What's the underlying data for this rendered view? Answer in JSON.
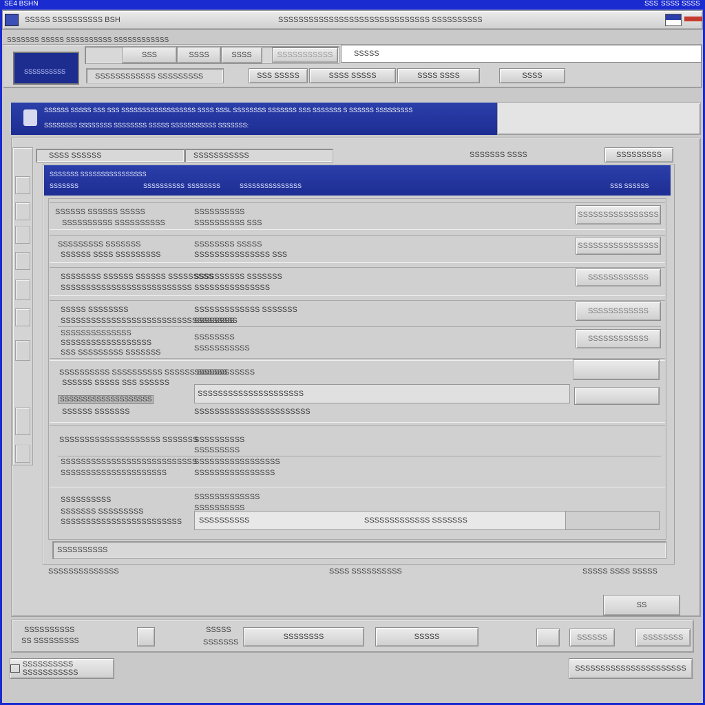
{
  "titlebar": {
    "title": "SE4 BSHN",
    "controls": [
      "SSS",
      "SSSS",
      "SSSS"
    ]
  },
  "menubar": {
    "left": "SSSSS  SSSSSSSSSS BSH",
    "center": "SSSSSSSSSSSSSSSSSSSSSSSSSSSSSS SSSSSSSSSS"
  },
  "toolbar": {
    "caption": "SSSSSSS SSSSS SSSSSSSSSS SSSSSSSSSSSS",
    "preview_text": "SSSSSSSSSS",
    "top_tabs": [
      "SSS",
      "SSSS",
      "SSSS",
      "SSSSSSSSSSS"
    ],
    "search_value": "SSSSS",
    "subtitle": "SSSSSSSSSSSS SSSSSSSSS",
    "sub_tabs": [
      "SSS SSSSS",
      "SSSS SSSSS",
      "SSSS SSSS",
      "SSSS"
    ]
  },
  "banner": {
    "line1": "SSSSSS SSSSS SSS SSS SSSSSSSSSSSSSSSSSS SSSS SSSL SSSSSSSS SSSSSSS SSS SSSSSSS S SSSSSS SSSSSSSSS",
    "line2": "SSSSSSSS SSSSSSSS SSSSSSSS SSSSS SSSSSSSSSSS SSSSSSS:"
  },
  "subheader": {
    "left": "SSSS  SSSSSS",
    "middle": "SSSSSSSSSSS",
    "right": "SSSSSSS  SSSS",
    "button": "SSSSSSSSS"
  },
  "group_header": {
    "title": "SSSSSSS SSSSSSSSSSSSSSSS",
    "cols": [
      "SSSSSSS",
      "SSSSSSSSSS",
      "SSSSSSSS",
      "SSSSSSSSSSSSSSS"
    ],
    "right": "SSS SSSSSS"
  },
  "rows": [
    {
      "label": "SSSSSS SSSSSS SSSSS",
      "sub": "SSSSSSSSSS SSSSSSSSSS",
      "value": "SSSSSSSSSS",
      "value2": "SSSSSSSSSS SSS",
      "button": "SSSSSSSSSSSSSSSS"
    },
    {
      "label": "SSSSSSSSS SSSSSSS",
      "sub": "SSSSSS SSSS SSSSSSSSS",
      "value": "SSSSSSSS SSSSS",
      "value2": "SSSSSSSSSSSSSSS SSS",
      "button": "SSSSSSSSSSSSSSSS"
    },
    {
      "label": "SSSSSSSS SSSSSS  SSSSSS SSSSSSSSS",
      "sub": "SSSSSSSSSSSSSSSSSSSSSSSSSS",
      "value": "SSSSSSSSSS SSSSSSS",
      "value2": "SSSSSSSSSSSSSSS",
      "button": "SSSSSSSSSSSS"
    },
    {
      "label": "SSSSS SSSSSSSS",
      "sub": "SSSSSSSSSSSSSSSSSSSSSSSSSSSSSSSSSSS",
      "value": "SSSSSSSSSSSSS SSSSSSS",
      "value2": "SSSSSSSS",
      "button": "SSSSSSSSSSSS"
    },
    {
      "label": "SSSSSSSSSSSSSS",
      "sub": "SSSSSSSSSSSSSSSSSS",
      "extra": "SSS SSSSSSSSS SSSSSSS",
      "value": "SSSSSSSS",
      "value2": "SSSSSSSSSSS",
      "button": "SSSSSSSSSSSS"
    },
    {
      "label": "SSSSSSSSSS SSSSSSSSSS SSSSSS SSSSSS",
      "sub": "SSSSSS SSSSS SSS SSSSSS",
      "sub2": "SSSSSSSSSSSSSSSSSSSS",
      "sub3": "SSSSSS SSSSSSS",
      "value": "SSSSSSSSSSSS",
      "field": "SSSSSSSSSSSSSSSSSSSSS",
      "value2": "SSSSSSSSSSSSSSSSSSSSSSS"
    },
    {
      "label": "SSSSSSSSSSSSSSSSSSSS SSSSSSS",
      "sub": "SSSSSSSSSSSSSSSSSSSSSSSSSSS",
      "sub2": "SSSSSSSSSSSSSSSSSSSSS",
      "value": "SSSSSSSSSS",
      "value2": "SSSSSSSSS",
      "value3": "SSSSSSSSSSSSSSSSS",
      "value4": "SSSSSSSSSSSSSSSS"
    },
    {
      "label": "SSSSSSSSSS",
      "sub": "SSSSSSS SSSSSSSSS",
      "sub2": "SSSSSSSSSSSSSSSSSSSSSSSS",
      "value": "SSSSSSSSSSSSS",
      "value2": "SSSSSSSSSS",
      "field": "SSSSSSSSSS",
      "field2": "SSSSSSSSSSSSS  SSSSSSS"
    }
  ],
  "footer_note": "SSSSSSSSSS",
  "status": {
    "left": "SSSSSSSSSSSSSS",
    "middle": "SSSS  SSSSSSSSSS",
    "right": "SSSSS SSSS SSSSS"
  },
  "bottom": {
    "ok_button": "SS",
    "info1": "SSSSSSSSSS",
    "info2": "SS SSSSSSSSS",
    "info3": "SSSSS",
    "info4": "SSSSSSS",
    "btn_a": "SSSSSSSS",
    "btn_b": "SSSSS",
    "btn_c": "SSSSSS",
    "btn_d": "SSSSSSSS",
    "left_button": "SSSSSSSSSS SSSSSSSSSSS",
    "right_button": "SSSSSSSSSSSSSSSSSSSSSS"
  },
  "colors": {
    "accent": "#1d2d93",
    "bar": "#2b3faa",
    "frame": "#1a2ccf"
  }
}
